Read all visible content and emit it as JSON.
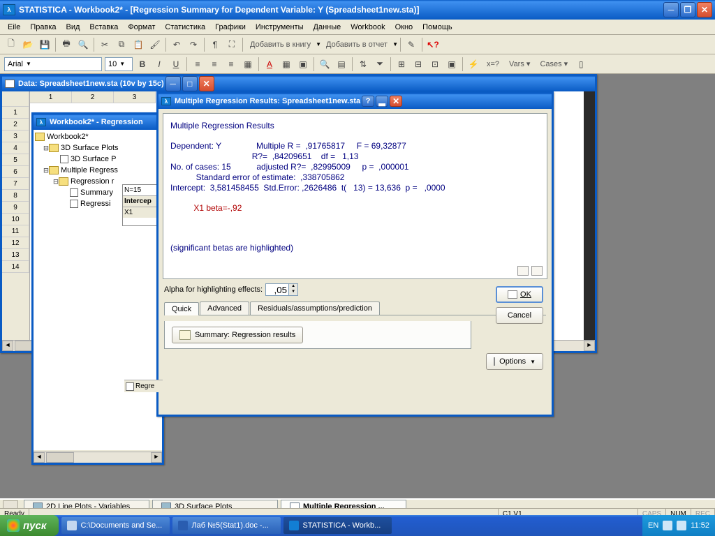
{
  "main_title": "STATISTICA - Workbook2* - [Regression Summary for Dependent Variable: Y (Spreadsheet1new.sta)]",
  "menu": [
    "Eile",
    "Правка",
    "Вид",
    "Вставка",
    "Формат",
    "Статистика",
    "Графики",
    "Инструменты",
    "Данные",
    "Workbook",
    "Окно",
    "Помощь"
  ],
  "toolbar2": {
    "add_book": "Добавить в книгу",
    "add_report": "Добавить в отчет"
  },
  "font": {
    "name": "Arial",
    "size": "10",
    "vars": "Vars",
    "cases": "Cases"
  },
  "spreadsheet_title": "Data: Spreadsheet1new.sta (10v by 15c)",
  "workbook_title": "Workbook2* - Regression",
  "tree": {
    "root": "Workbook2*",
    "n1": "3D Surface Plots",
    "n2": "3D Surface P",
    "n3": "Multiple Regress",
    "n4": "Regression r",
    "n5": "Summary",
    "n6": "Regressi"
  },
  "ws_sheet": {
    "n": "N=15",
    "intercept": "Intercep",
    "x1": "X1"
  },
  "dialog": {
    "title": "Multiple Regression Results: Spreadsheet1new.sta",
    "report_line1": "Multiple Regression Results",
    "report_line2": "Dependent: Y               Multiple R =  ,91765817     F = 69,32877",
    "report_line3": "                                   R?=  ,84209651    df =   1,13",
    "report_line4": "No. of cases: 15           adjusted R?=  ,82995009     p =  ,000001",
    "report_line5": "           Standard error of estimate:  ,338705862",
    "report_line6": "Intercept:  3,581458455  Std.Error: ,2626486  t(   13) = 13,636  p =   ,0000",
    "report_beta": "          X1 beta=-,92",
    "report_sig": "(significant betas are highlighted)",
    "alpha_label": "Alpha for highlighting effects:",
    "alpha_value": ",05",
    "tabs": {
      "quick": "Quick",
      "advanced": "Advanced",
      "resid": "Residuals/assumptions/prediction"
    },
    "summary_btn": "Summary: Regression results",
    "ok": "OK",
    "cancel": "Cancel",
    "options": "Options"
  },
  "bottom_tabs": {
    "t1": "2D Line Plots - Variables",
    "t2": "3D Surface Plots",
    "t3": "Multiple Regression ..."
  },
  "status": {
    "ready": "Ready",
    "cell": "C1,V1",
    "caps": "CAPS",
    "num": "NUM",
    "rec": "REC"
  },
  "taskbar": {
    "start": "пуск",
    "t1": "C:\\Documents and Se...",
    "t2": "Лаб №5(Stat1).doc -...",
    "t3": "STATISTICA - Workb...",
    "lang": "EN",
    "time": "11:52"
  }
}
